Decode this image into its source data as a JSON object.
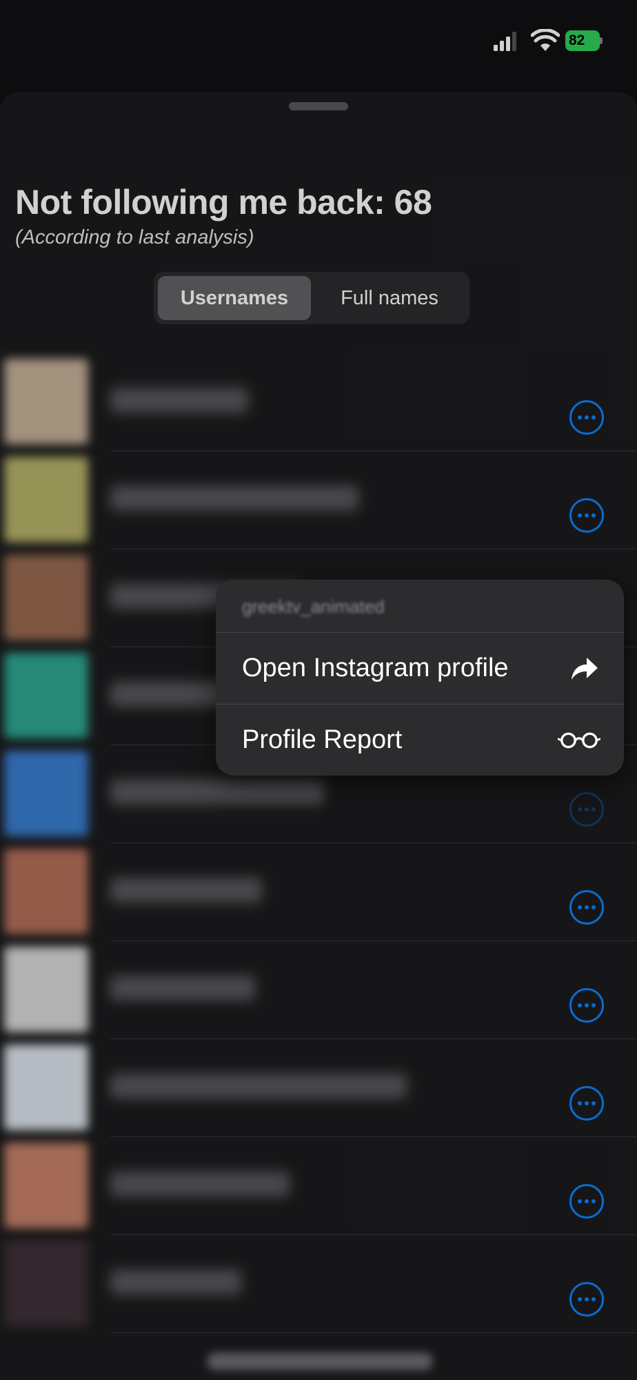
{
  "status_bar": {
    "battery": "82",
    "battery_color": "#2fd158"
  },
  "header": {
    "title": "Not following me back: 68",
    "subtitle": "(According to last analysis)"
  },
  "segmented_control": {
    "options": [
      "Usernames",
      "Full names"
    ],
    "selected": "Usernames"
  },
  "list": {
    "avatar_colors": [
      "#c7b29a",
      "#b8b46a",
      "#9a6b52",
      "#2fa892",
      "#3a7fd1",
      "#b6705a",
      "#d9d9d9",
      "#dfe6ee",
      "#c8826a",
      "#3e3138"
    ]
  },
  "context_menu": {
    "header": "greektv_animated",
    "items": [
      {
        "label": "Open Instagram profile",
        "icon": "share-arrow-icon"
      },
      {
        "label": "Profile Report",
        "icon": "eyeglasses-icon"
      }
    ]
  },
  "colors": {
    "accent": "#0a84ff",
    "sheet_bg": "#1c1c1e",
    "menu_bg": "#2c2c2e"
  }
}
